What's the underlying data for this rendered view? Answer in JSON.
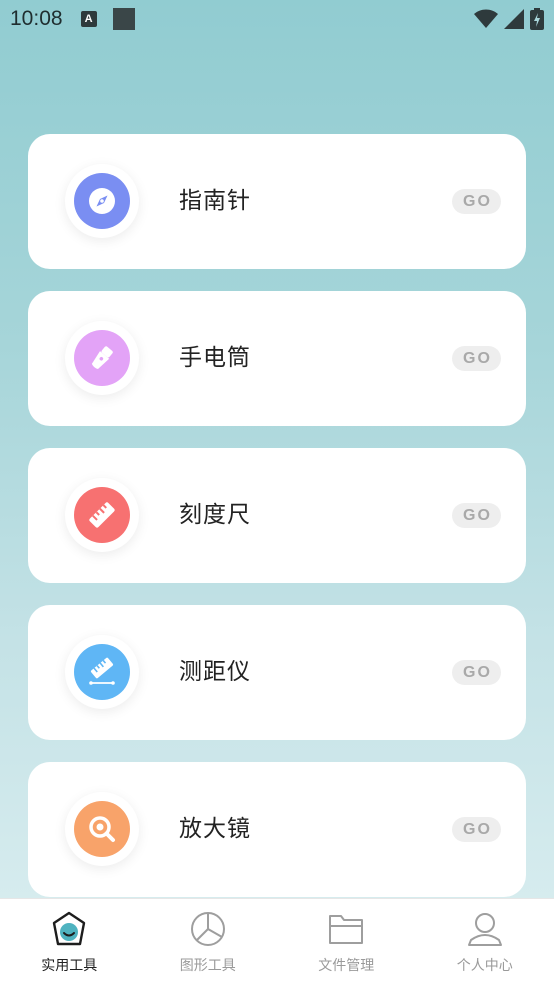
{
  "status_bar": {
    "time": "10:08",
    "notification_icon": "A"
  },
  "tools": [
    {
      "label": "指南针",
      "icon": "compass-icon",
      "color": "#7a8ef2",
      "go": "GO"
    },
    {
      "label": "手电筒",
      "icon": "flashlight-icon",
      "color": "#e3a3f7",
      "go": "GO"
    },
    {
      "label": "刻度尺",
      "icon": "ruler-icon",
      "color": "#f77171",
      "go": "GO"
    },
    {
      "label": "测距仪",
      "icon": "rangefinder-icon",
      "color": "#5fb6f5",
      "go": "GO"
    },
    {
      "label": "放大镜",
      "icon": "magnifier-icon",
      "color": "#f8a36a",
      "go": "GO"
    }
  ],
  "tabbar": [
    {
      "label": "实用工具",
      "icon": "tools-icon",
      "active": true
    },
    {
      "label": "图形工具",
      "icon": "pie-chart-icon",
      "active": false
    },
    {
      "label": "文件管理",
      "icon": "folder-icon",
      "active": false
    },
    {
      "label": "个人中心",
      "icon": "user-icon",
      "active": false
    }
  ]
}
